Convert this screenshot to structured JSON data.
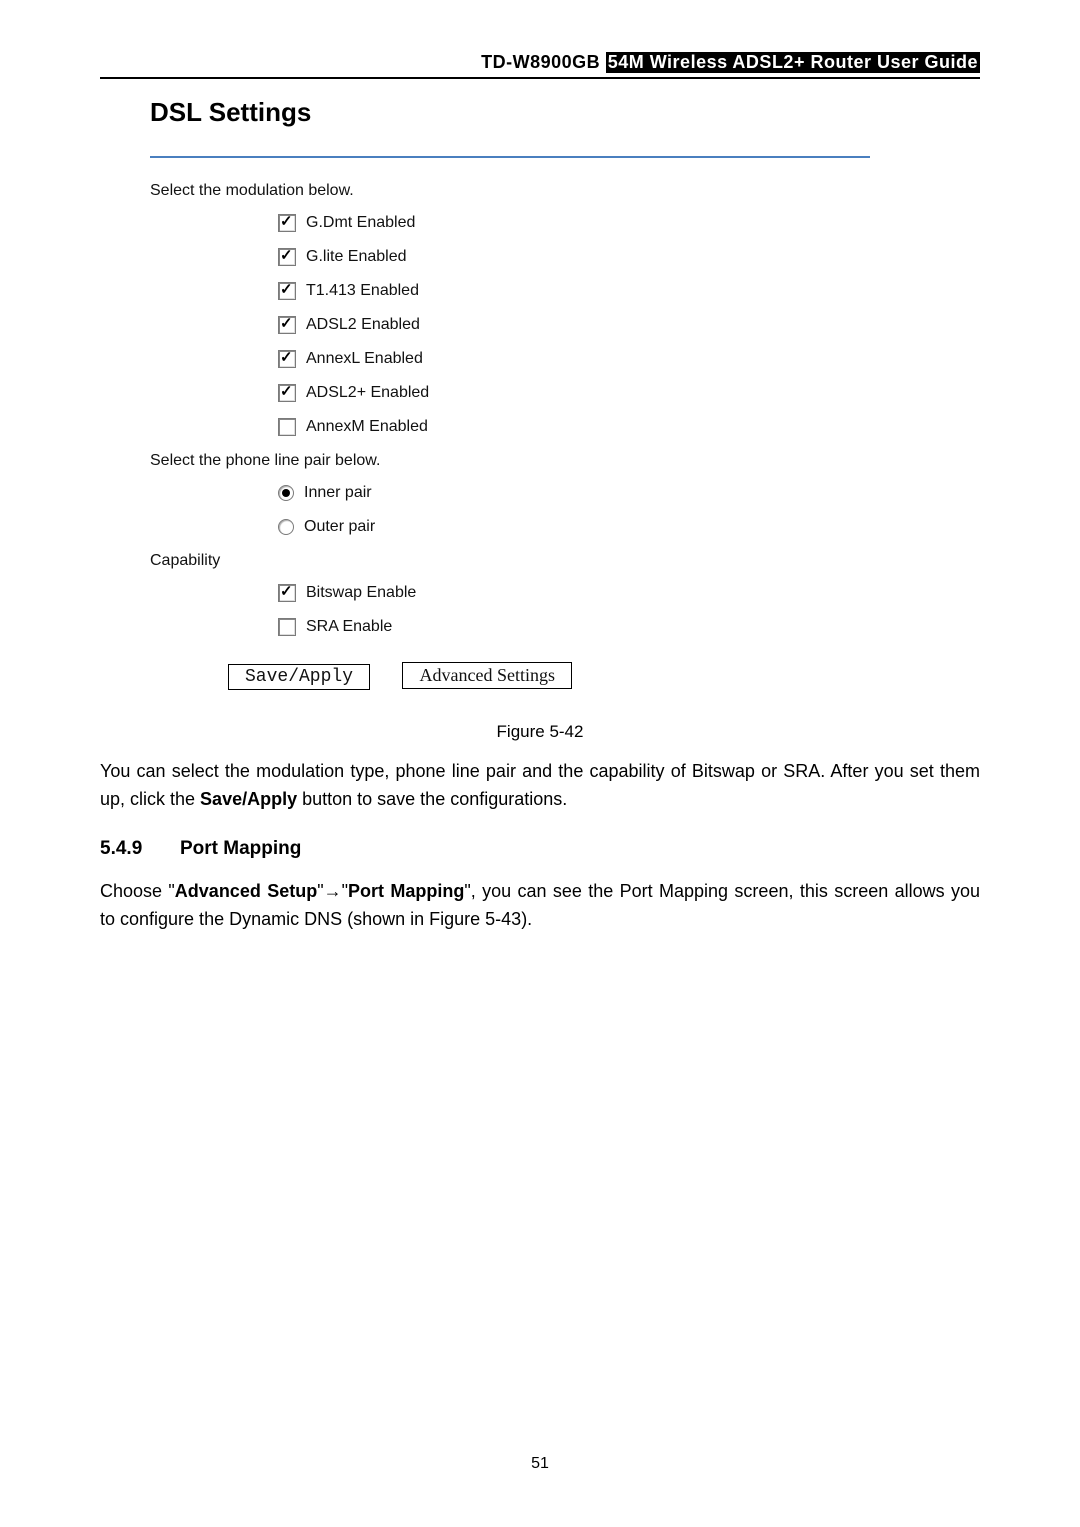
{
  "header": {
    "model": "TD-W8900GB",
    "title": "54M Wireless ADSL2+ Router User Guide"
  },
  "figure": {
    "title": "DSL Settings",
    "modulation_label": "Select the modulation below.",
    "modulation": [
      {
        "label": "G.Dmt Enabled",
        "checked": true
      },
      {
        "label": "G.lite Enabled",
        "checked": true
      },
      {
        "label": "T1.413 Enabled",
        "checked": true
      },
      {
        "label": "ADSL2 Enabled",
        "checked": true
      },
      {
        "label": "AnnexL Enabled",
        "checked": true
      },
      {
        "label": "ADSL2+ Enabled",
        "checked": true
      },
      {
        "label": "AnnexM Enabled",
        "checked": false
      }
    ],
    "pair_label": "Select the phone line pair below.",
    "pair": [
      {
        "label": "Inner pair",
        "selected": true
      },
      {
        "label": "Outer pair",
        "selected": false
      }
    ],
    "capability_label": "Capability",
    "capability": [
      {
        "label": "Bitswap Enable",
        "checked": true
      },
      {
        "label": "SRA Enable",
        "checked": false
      }
    ],
    "buttons": {
      "save": "Save/Apply",
      "adv": "Advanced Settings"
    }
  },
  "caption": "Figure 5-42",
  "para1_a": "You can select the modulation type, phone line pair and the capability of Bitswap or SRA. After you set them up, click the ",
  "para1_b": "Save/Apply",
  "para1_c": " button to save the configurations.",
  "subhead": {
    "num": "5.4.9",
    "title": "Port Mapping"
  },
  "para2_a": "Choose \"",
  "para2_b": "Advanced Setup",
  "para2_c": "\"",
  "para2_arrow": "→",
  "para2_d": "\"",
  "para2_e": "Port Mapping",
  "para2_f": "\", you can see the Port Mapping screen, this screen allows you to configure the Dynamic DNS (shown in Figure 5-43).",
  "page_number": "51"
}
